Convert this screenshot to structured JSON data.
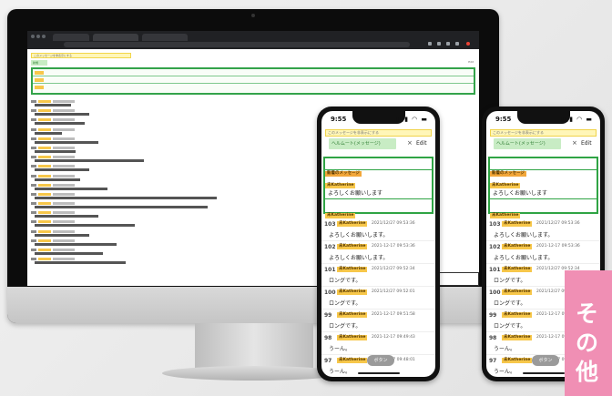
{
  "monitor": {
    "banner_text": "このメッセージを非表示にする",
    "input_label": "新規",
    "edit_label": "Edit"
  },
  "phones": [
    {
      "status_time": "9:55",
      "status_signal": "▮▮▮ ◠ ▬",
      "banner_text": "このメッセージを非表示にする",
      "input_value": "ヘルムート(メッセージ)",
      "clear_icon": "×",
      "edit_label": "Edit",
      "pinned": [
        {
          "author": "新着のメッセージ"
        },
        {
          "author": "未Katherine",
          "text": "よろしくお願いします"
        },
        {
          "author": "未Katherine"
        }
      ],
      "messages": [
        {
          "num": "103",
          "author": "未Katherine",
          "timestamp": "2021/12/27 09:53:36",
          "text": "よろしくお願いします。"
        },
        {
          "num": "102",
          "author": "未Katherine",
          "timestamp": "2021-12-17 09:53:36",
          "text": "よろしくお願いします。"
        },
        {
          "num": "101",
          "author": "未Katherine",
          "timestamp": "2021/12/27 09:52:34",
          "text": "ロングです。"
        },
        {
          "num": "100",
          "author": "未Katherine",
          "timestamp": "2021/12/27 09:52:01",
          "text": "ロングです。"
        },
        {
          "num": "99",
          "author": "未Katherine",
          "timestamp": "2021-12-17 09:51:58",
          "text": "ロングです。"
        },
        {
          "num": "98",
          "author": "未Katherine",
          "timestamp": "2021-12-17 09:49:43",
          "text": "うーん。"
        },
        {
          "num": "97",
          "author": "未Katherine",
          "timestamp": "2021-12-17 09:48:01",
          "text": "うーん。"
        }
      ],
      "fab_label": "ボタン"
    },
    {
      "status_time": "9:55",
      "status_signal": "▮▮▮ ◠ ▬",
      "banner_text": "このメッセージを非表示にする",
      "input_value": "ヘルムート(メッセージ)",
      "clear_icon": "×",
      "edit_label": "Edit",
      "pinned": [
        {
          "author": "新着のメッセージ"
        },
        {
          "author": "未Katherine",
          "text": "よろしくお願いします"
        },
        {
          "author": "未Katherine"
        }
      ],
      "messages": [
        {
          "num": "103",
          "author": "未Katherine",
          "timestamp": "2021/12/27 09:53:36",
          "text": "よろしくお願いします。"
        },
        {
          "num": "102",
          "author": "未Katherine",
          "timestamp": "2021-12-17 09:53:36",
          "text": "よろしくお願いします。"
        },
        {
          "num": "101",
          "author": "未Katherine",
          "timestamp": "2021/12/27 09:52:34",
          "text": "ロングです。"
        },
        {
          "num": "100",
          "author": "未Katherine",
          "timestamp": "2021/12/27 09:52:01",
          "text": "ロングです。"
        },
        {
          "num": "99",
          "author": "未Katherine",
          "timestamp": "2021-12-17 09:51:58",
          "text": "ロングです。"
        },
        {
          "num": "98",
          "author": "未Katherine",
          "timestamp": "2021-12-17 09:49:43",
          "text": "うーん。"
        },
        {
          "num": "97",
          "author": "未Katherine",
          "timestamp": "2021-12-17 09:48:01",
          "text": "うーん。"
        }
      ],
      "fab_label": "ボタン"
    }
  ],
  "badge": {
    "chars": [
      "そ",
      "の",
      "他"
    ]
  },
  "colors": {
    "accent_green": "#2fa444",
    "chip_yellow": "#f7c74a",
    "badge_pink": "#f08fb4",
    "banner_yellow": "#fff6b8"
  },
  "icons": {
    "clear": "close-icon",
    "signal": "signal-icon"
  }
}
